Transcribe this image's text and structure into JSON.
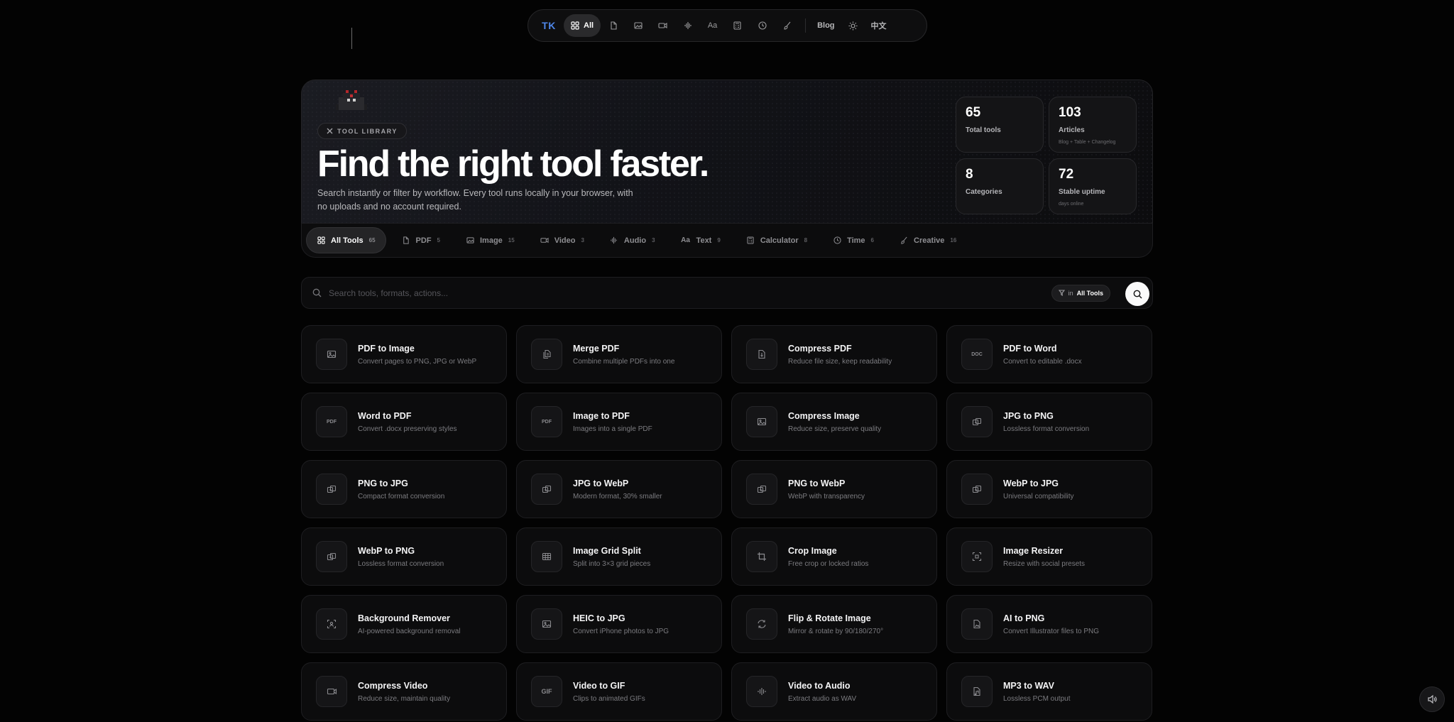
{
  "nav": {
    "logo": "TK",
    "all_label": "All",
    "icons": [
      "pdf-icon",
      "image-icon",
      "video-icon",
      "audio-icon",
      "text-icon",
      "calculator-icon",
      "clock-icon",
      "brush-icon"
    ],
    "blog_label": "Blog",
    "theme_icon": "sun-icon",
    "lang_label": "中文"
  },
  "hero": {
    "badge": "TOOL LIBRARY",
    "title": "Find the right tool faster.",
    "description": "Search instantly or filter by workflow. Every tool runs locally in your browser, with no uploads and no account required."
  },
  "stats": [
    {
      "value": "65",
      "label": "Total tools",
      "sub": ""
    },
    {
      "value": "103",
      "label": "Articles",
      "sub": "Blog + Table + Changelog"
    },
    {
      "value": "8",
      "label": "Categories",
      "sub": ""
    },
    {
      "value": "72",
      "label": "Stable uptime",
      "sub": "days online"
    }
  ],
  "categories": [
    {
      "label": "All Tools",
      "count": "65",
      "icon": "grid-icon"
    },
    {
      "label": "PDF",
      "count": "5",
      "icon": "pdf-icon"
    },
    {
      "label": "Image",
      "count": "15",
      "icon": "image-icon"
    },
    {
      "label": "Video",
      "count": "3",
      "icon": "video-icon"
    },
    {
      "label": "Audio",
      "count": "3",
      "icon": "audio-icon"
    },
    {
      "label": "Text",
      "count": "9",
      "icon": "text-icon"
    },
    {
      "label": "Calculator",
      "count": "8",
      "icon": "calculator-icon"
    },
    {
      "label": "Time",
      "count": "6",
      "icon": "clock-icon"
    },
    {
      "label": "Creative",
      "count": "16",
      "icon": "brush-icon"
    }
  ],
  "search": {
    "placeholder": "Search tools, formats, actions...",
    "scope_prefix": "in",
    "scope_value": "All Tools"
  },
  "tools": [
    {
      "title": "PDF to Image",
      "desc": "Convert pages to PNG, JPG or WebP",
      "icon": "image-icon"
    },
    {
      "title": "Merge PDF",
      "desc": "Combine multiple PDFs into one",
      "icon": "merge-icon"
    },
    {
      "title": "Compress PDF",
      "desc": "Reduce file size, keep readability",
      "icon": "file-compress-icon"
    },
    {
      "title": "PDF to Word",
      "desc": "Convert to editable .docx",
      "icon": "doc-icon"
    },
    {
      "title": "Word to PDF",
      "desc": "Convert .docx preserving styles",
      "icon": "pdf-icon"
    },
    {
      "title": "Image to PDF",
      "desc": "Images into a single PDF",
      "icon": "pdf-icon"
    },
    {
      "title": "Compress Image",
      "desc": "Reduce size, preserve quality",
      "icon": "image-icon"
    },
    {
      "title": "JPG to PNG",
      "desc": "Lossless format conversion",
      "icon": "convert-icon"
    },
    {
      "title": "PNG to JPG",
      "desc": "Compact format conversion",
      "icon": "convert-icon"
    },
    {
      "title": "JPG to WebP",
      "desc": "Modern format, 30% smaller",
      "icon": "convert-icon"
    },
    {
      "title": "PNG to WebP",
      "desc": "WebP with transparency",
      "icon": "convert-icon"
    },
    {
      "title": "WebP to JPG",
      "desc": "Universal compatibility",
      "icon": "convert-icon"
    },
    {
      "title": "WebP to PNG",
      "desc": "Lossless format conversion",
      "icon": "convert-icon"
    },
    {
      "title": "Image Grid Split",
      "desc": "Split into 3×3 grid pieces",
      "icon": "grid-split-icon"
    },
    {
      "title": "Crop Image",
      "desc": "Free crop or locked ratios",
      "icon": "crop-icon"
    },
    {
      "title": "Image Resizer",
      "desc": "Resize with social presets",
      "icon": "resize-icon"
    },
    {
      "title": "Background Remover",
      "desc": "AI-powered background removal",
      "icon": "scan-icon"
    },
    {
      "title": "HEIC to JPG",
      "desc": "Convert iPhone photos to JPG",
      "icon": "image-icon"
    },
    {
      "title": "Flip & Rotate Image",
      "desc": "Mirror & rotate by 90/180/270°",
      "icon": "rotate-icon"
    },
    {
      "title": "AI to PNG",
      "desc": "Convert Illustrator files to PNG",
      "icon": "file-image-icon"
    },
    {
      "title": "Compress Video",
      "desc": "Reduce size, maintain quality",
      "icon": "video-icon"
    },
    {
      "title": "Video to GIF",
      "desc": "Clips to animated GIFs",
      "icon": "gif-icon"
    },
    {
      "title": "Video to Audio",
      "desc": "Extract audio as WAV",
      "icon": "audio-icon"
    },
    {
      "title": "MP3 to WAV",
      "desc": "Lossless PCM output",
      "icon": "file-audio-icon"
    }
  ],
  "sound_icon": "speaker-icon"
}
